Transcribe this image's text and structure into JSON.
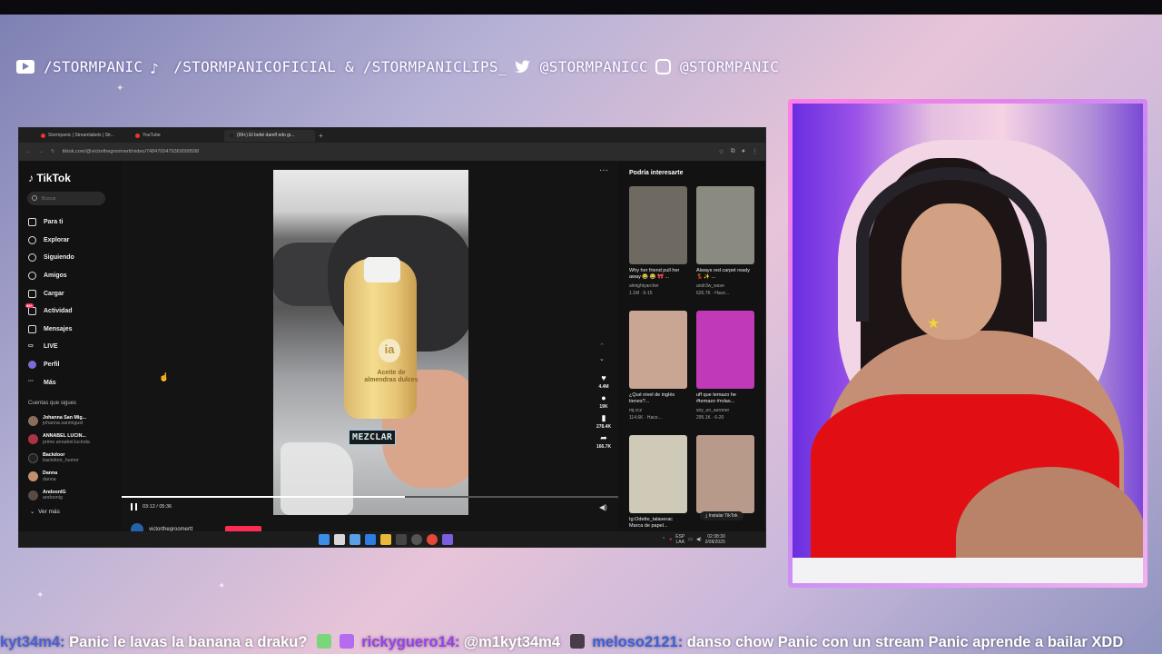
{
  "overlay": {
    "socials": [
      {
        "icon": "youtube-icon",
        "text": "/STORMPANIC"
      },
      {
        "icon": "tiktok-icon",
        "text": "/STORMPANICOFICIAL & /STORMPANICLIPS_"
      },
      {
        "icon": "twitter-icon",
        "text": "@STORMPANICC"
      },
      {
        "icon": "instagram-icon",
        "text": "@STORMPANIC"
      }
    ]
  },
  "browser": {
    "tabs": [
      {
        "label": "Stormpanic | Streamlabels | Str..."
      },
      {
        "label": "YouTube"
      },
      {
        "label": "(99+) El bebé darelf edo gi..."
      }
    ],
    "url": "tiktok.com/@victorthegroomertt/video/7484700479369099598",
    "tiktok": {
      "logo": "TikTok",
      "search_placeholder": "Buscar",
      "nav": [
        {
          "label": "Para ti",
          "icon": "home-icon"
        },
        {
          "label": "Explorar",
          "icon": "compass-icon"
        },
        {
          "label": "Siguiendo",
          "icon": "following-icon"
        },
        {
          "label": "Amigos",
          "icon": "friends-icon"
        },
        {
          "label": "Cargar",
          "icon": "upload-icon"
        },
        {
          "label": "Actividad",
          "icon": "activity-icon",
          "badge": "99+"
        },
        {
          "label": "Mensajes",
          "icon": "messages-icon"
        },
        {
          "label": "LIVE",
          "icon": "live-icon"
        },
        {
          "label": "Perfil",
          "icon": "profile-icon"
        },
        {
          "label": "Más",
          "icon": "more-icon"
        }
      ],
      "following_header": "Cuentas que sigues",
      "following": [
        {
          "name": "Johanna San Mig...",
          "user": "johanna.sanmiguel"
        },
        {
          "name": "ANNABEL LUCIN...",
          "user": "prime.annabel.lucinda"
        },
        {
          "name": "Backdoor",
          "user": "backdoor_humor"
        },
        {
          "name": "Danna",
          "user": "danna"
        },
        {
          "name": "AndoonIG",
          "user": "andoonig"
        }
      ],
      "see_more": "Ver más",
      "video": {
        "overlay_text": "MEZCLAR",
        "bottle_brand": "ia",
        "bottle_label": "Aceite de almendras dulces",
        "time": "03:12 / 05:36",
        "progress": 0.57,
        "likes": "4.4M",
        "comments": "19K",
        "saves": "278.4K",
        "shares": "166.7K",
        "author": "victorthegroomertt"
      },
      "recommended_header": "Podría interesarte",
      "recommended": [
        {
          "title": "Why her friend pull her away 😂 😂 🎀 ...",
          "user": "almightyarcher",
          "stats": "1.1M · 6-15",
          "color": "#6e6a62"
        },
        {
          "title": "Always red carpet ready💃 ✨ ...",
          "user": "andr3w_wave",
          "stats": "626.7K · Hace...",
          "color": "#8a8a80"
        },
        {
          "title": "¿Qué nivel de inglés tienes?...",
          "user": "mj.ccz",
          "stats": "114.6K · Hace...",
          "color": "#c9a594"
        },
        {
          "title": "uff que temazo he #temazo #rolas...",
          "user": "soy_un_auroner",
          "stats": "295.1K · 6-20",
          "color": "#c03ab8"
        },
        {
          "title": "Ig:Odette_talaverac Marca de papel...",
          "user": "",
          "stats": "",
          "color": "#cfc9b8"
        },
        {
          "title": "",
          "user": "",
          "stats": "",
          "color": "#b89a8a"
        }
      ],
      "install": "Instalar TikTok"
    },
    "taskbar": {
      "lang": "ESP\nLAA",
      "time": "02:38:30",
      "date": "2/08/2025"
    }
  },
  "chat": [
    {
      "user": "kyt34m4:",
      "message": "Panic le lavas la banana a draku?"
    },
    {
      "user": "rickyguero14:",
      "message": "@m1kyt34m4"
    },
    {
      "user": "meloso2121:",
      "message": "danso chow Panic con un stream Panic aprende a bailar XDD"
    }
  ]
}
